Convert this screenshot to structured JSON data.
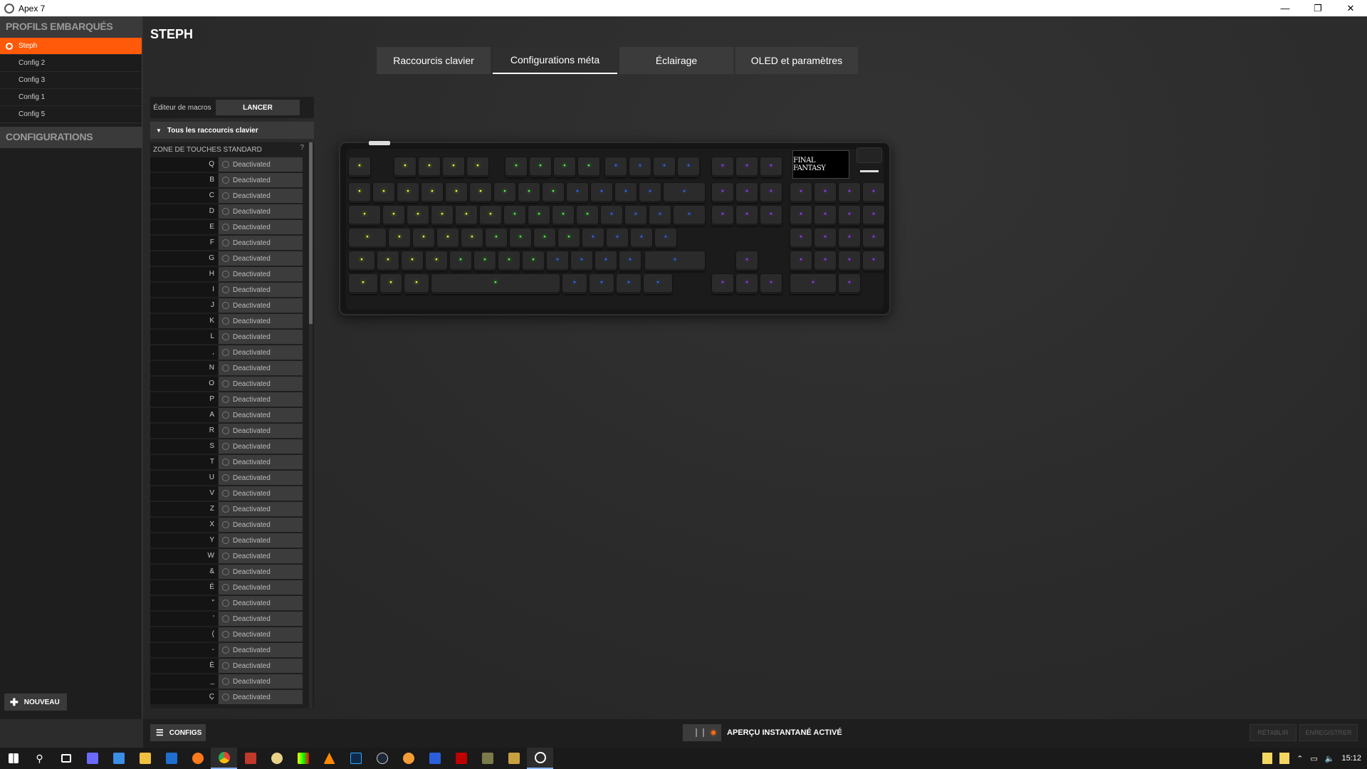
{
  "window": {
    "title": "Apex 7",
    "controls": [
      "—",
      "❐",
      "✕"
    ]
  },
  "sidebar": {
    "profiles_header": "PROFILS EMBARQUÉS",
    "profiles": [
      {
        "label": "Steph",
        "active": true
      },
      {
        "label": "Config 2"
      },
      {
        "label": "Config 3"
      },
      {
        "label": "Config 1"
      },
      {
        "label": "Config 5"
      }
    ],
    "configs_header": "CONFIGURATIONS",
    "new_label": "NOUVEAU"
  },
  "main": {
    "profile_title": "STEPH",
    "tabs": [
      {
        "label": "Raccourcis clavier"
      },
      {
        "label": "Configurations méta",
        "active": true
      },
      {
        "label": "Éclairage"
      },
      {
        "label": "OLED et paramètres"
      }
    ],
    "macro_editor_label": "Éditeur de macros",
    "launch_label": "LANCER",
    "shortcut_filter": "Tous les raccourcis clavier",
    "zone_label": "ZONE DE TOUCHES STANDARD",
    "help": "?",
    "key_value": "Deactivated",
    "keys": [
      "Q",
      "B",
      "C",
      "D",
      "E",
      "F",
      "G",
      "H",
      "I",
      "J",
      "K",
      "L",
      ",",
      "N",
      "O",
      "P",
      "A",
      "R",
      "S",
      "T",
      "U",
      "V",
      "Z",
      "X",
      "Y",
      "W",
      "&",
      "É",
      "\"",
      "'",
      "(",
      "-",
      "È",
      "_",
      "Ç"
    ],
    "oled_text": "FINAL FANTASY"
  },
  "bottom": {
    "configs_label": "CONFIGS",
    "preview_label": "APERÇU INSTANTANÉ ACTIVÉ",
    "revert_label": "RÉTABLIR",
    "save_label": "ENREGISTRER"
  },
  "taskbar": {
    "time": "15:12"
  },
  "colors": {
    "accent": "#ff5a0a",
    "green": "#4cff3a",
    "blue": "#2e6cff",
    "violet": "#9a3cff",
    "yellow": "#e8ff2a"
  }
}
